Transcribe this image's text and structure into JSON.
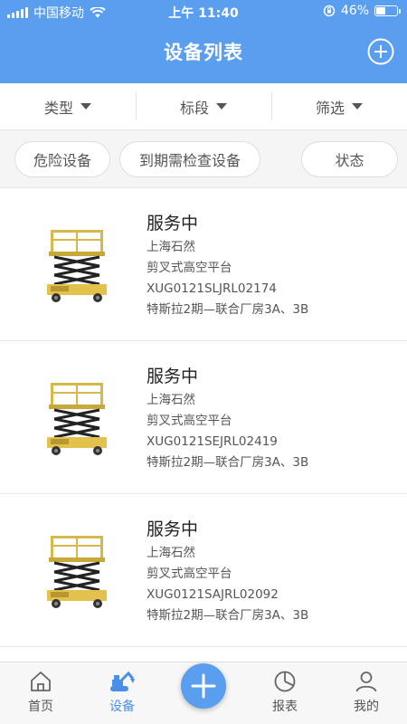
{
  "status_bar": {
    "carrier": "中国移动",
    "time": "上午 11:40",
    "battery_percent": "46%",
    "battery_level": 0.46
  },
  "header": {
    "title": "设备列表",
    "add_icon": "plus-circle-icon"
  },
  "filters": [
    {
      "label": "类型"
    },
    {
      "label": "标段"
    },
    {
      "label": "筛选"
    }
  ],
  "chips": [
    {
      "label": "危险设备"
    },
    {
      "label": "到期需检查设备"
    },
    {
      "label": "状态"
    }
  ],
  "devices": [
    {
      "status": "服务中",
      "company": "上海石然",
      "type": "剪叉式高空平台",
      "serial": "XUG0121SLJRL02174",
      "location": "特斯拉2期—联合厂房3A、3B"
    },
    {
      "status": "服务中",
      "company": "上海石然",
      "type": "剪叉式高空平台",
      "serial": "XUG0121SEJRL02419",
      "location": "特斯拉2期—联合厂房3A、3B"
    },
    {
      "status": "服务中",
      "company": "上海石然",
      "type": "剪叉式高空平台",
      "serial": "XUG0121SAJRL02092",
      "location": "特斯拉2期—联合厂房3A、3B"
    }
  ],
  "tabbar": {
    "items": [
      {
        "label": "首页",
        "icon": "home-icon"
      },
      {
        "label": "设备",
        "icon": "excavator-icon",
        "active": true
      },
      {
        "label": "报表",
        "icon": "pie-chart-icon"
      },
      {
        "label": "我的",
        "icon": "user-icon"
      }
    ],
    "center_icon": "plus-icon"
  },
  "colors": {
    "primary": "#5a9ef0",
    "active_tab": "#4a8fe7"
  }
}
